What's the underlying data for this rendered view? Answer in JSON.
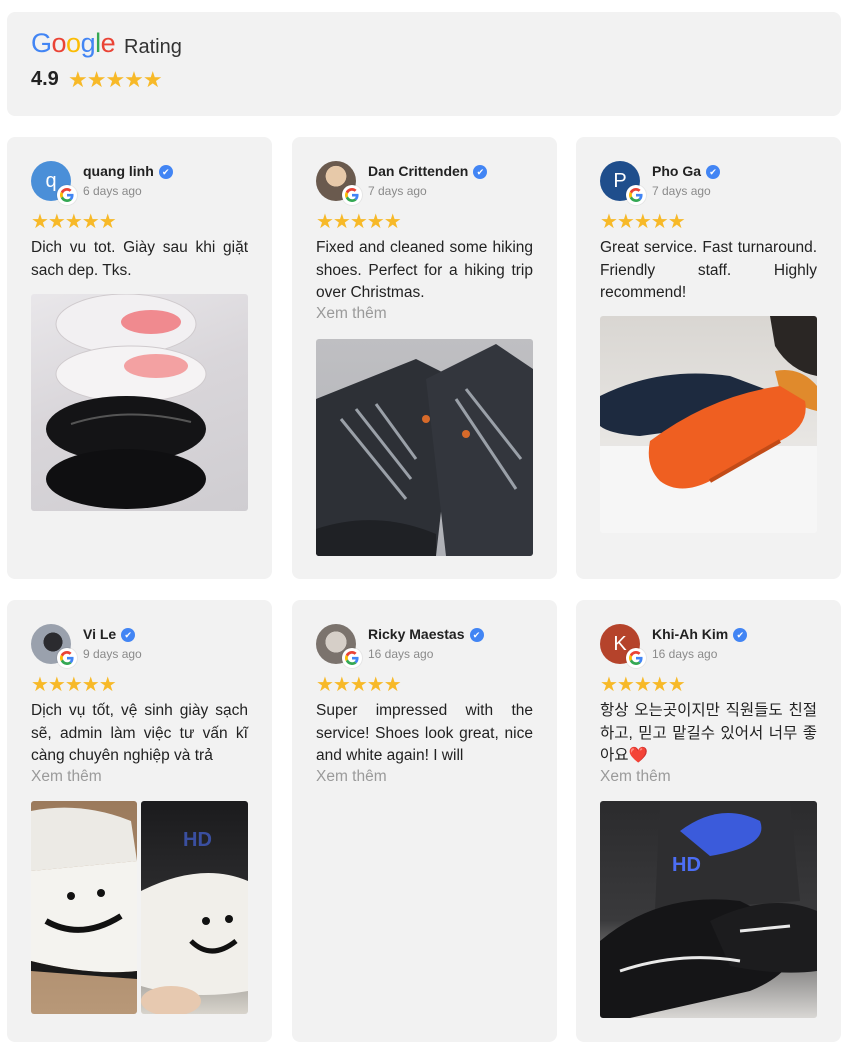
{
  "summary": {
    "logo_letters": [
      "G",
      "o",
      "o",
      "g",
      "l",
      "e"
    ],
    "logo_colors": [
      "#4285F4",
      "#EA4335",
      "#FBBC05",
      "#4285F4",
      "#34A853",
      "#EA4335"
    ],
    "rating_label": "Rating",
    "average": "4.9",
    "stars": "★★★★★"
  },
  "colors": {
    "star": "#f7b928",
    "card_bg": "#f2f2f2",
    "verified": "#4285f4",
    "muted": "#8a8a8a"
  },
  "reviews": [
    {
      "name": "quang linh",
      "date": "6 days ago",
      "avatar_letter": "q",
      "avatar_color": "#4a8fd8",
      "stars": "★★★★★",
      "text": "Dich vu tot. Giày sau khi giặt sach dep. Tks.",
      "more": ""
    },
    {
      "name": "Dan Crittenden",
      "date": "7 days ago",
      "avatar_letter": "",
      "avatar_color": "#8c7b6b",
      "stars": "★★★★★",
      "text": "Fixed and cleaned some hiking shoes. Perfect for a hiking trip over Christmas.",
      "more": "Xem thêm"
    },
    {
      "name": "Pho Ga",
      "date": "7 days ago",
      "avatar_letter": "P",
      "avatar_color": "#1f4e8c",
      "stars": "★★★★★",
      "text": "Great service. Fast turnaround. Friendly staff. Highly recommend!",
      "more": ""
    },
    {
      "name": "Vi Le",
      "date": "9 days ago",
      "avatar_letter": "",
      "avatar_color": "#6b6f78",
      "stars": "★★★★★",
      "text": "Dịch vụ tốt, vệ sinh giày sạch sẽ, admin làm việc tư vấn kĩ càng chuyên nghiệp và trả",
      "more": "Xem thêm"
    },
    {
      "name": "Ricky Maestas",
      "date": "16 days ago",
      "avatar_letter": "",
      "avatar_color": "#9a8f86",
      "stars": "★★★★★",
      "text": "Super impressed with the service! Shoes look great, nice and white again! I will",
      "more": "Xem thêm"
    },
    {
      "name": "Khi-Ah Kim",
      "date": "16 days ago",
      "avatar_letter": "K",
      "avatar_color": "#b5432b",
      "stars": "★★★★★",
      "text": "항상 오는곳이지만 직원들도 친절하고, 믿고 맡길수 있어서 너무 좋아요❤️",
      "more": "Xem thêm"
    }
  ],
  "icons": {
    "verified": "verified-check-icon",
    "google": "google-g-icon"
  },
  "photo_marks": {
    "glyph": "✔",
    "brand_text": "HD"
  }
}
